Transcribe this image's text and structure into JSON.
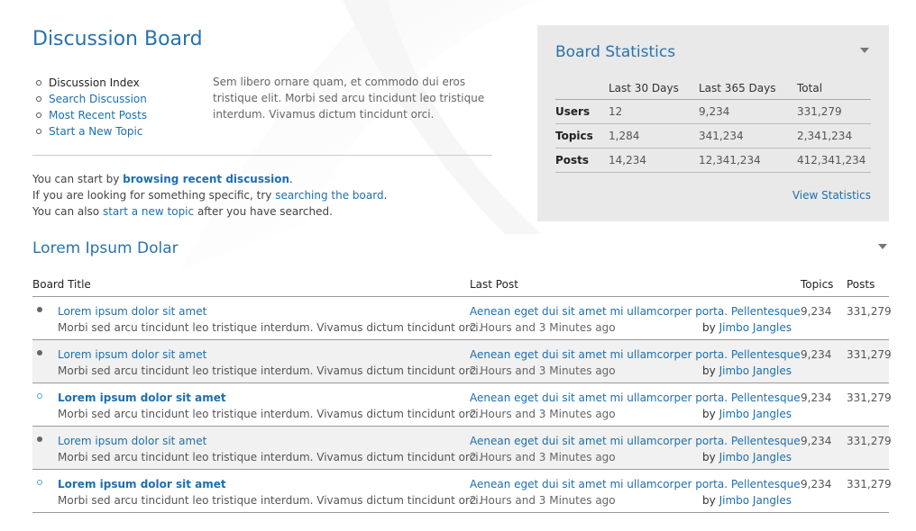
{
  "page": {
    "title": "Discussion Board"
  },
  "nav": {
    "items": [
      {
        "label": "Discussion Index"
      },
      {
        "label": "Search Discussion"
      },
      {
        "label": "Most Recent Posts"
      },
      {
        "label": "Start a New Topic"
      }
    ]
  },
  "intro": {
    "description": "Sem libero ornare quam, et commodo dui eros tristique elit. Morbi sed arcu tincidunt leo tristique interdum. Vivamus dictum tincidunt orci."
  },
  "help": {
    "line1_prefix": "You can start by ",
    "line1_link": "browsing recent discussion",
    "line1_suffix": ".",
    "line2_prefix": "If you are looking for something specific, try ",
    "line2_link": "searching the board",
    "line2_suffix": ".",
    "line3_prefix": "You can also ",
    "line3_link": "start a new topic",
    "line3_suffix": " after you have searched."
  },
  "stats": {
    "title": "Board Statistics",
    "columns": [
      "",
      "Last 30 Days",
      "Last 365 Days",
      "Total"
    ],
    "rows": [
      {
        "label": "Users",
        "last30": "12",
        "last365": "9,234",
        "total": "331,279"
      },
      {
        "label": "Topics",
        "last30": "1,284",
        "last365": "341,234",
        "total": "2,341,234"
      },
      {
        "label": "Posts",
        "last30": "14,234",
        "last365": "12,341,234",
        "total": "412,341,234"
      }
    ],
    "view_link": "View Statistics"
  },
  "section": {
    "title": "Lorem Ipsum Dolar",
    "headers": {
      "board_title": "Board Title",
      "last_post": "Last Post",
      "topics": "Topics",
      "posts": "Posts"
    },
    "rows": [
      {
        "title": "Lorem ipsum dolor sit amet",
        "desc": "Morbi sed arcu tincidunt leo tristique interdum. Vivamus dictum tincidunt orci.",
        "last_post": "Aenean eget dui sit amet mi ullamcorper porta. Pellentesque",
        "time": "2 Hours and 3 Minutes ago",
        "by_prefix": "by ",
        "author": "Jimbo Jangles",
        "topics": "9,234",
        "posts": "331,279"
      },
      {
        "title": "Lorem ipsum dolor sit amet",
        "desc": "Morbi sed arcu tincidunt leo tristique interdum. Vivamus dictum tincidunt orci.",
        "last_post": "Aenean eget dui sit amet mi ullamcorper porta. Pellentesque",
        "time": "2 Hours and 3 Minutes ago",
        "by_prefix": "by ",
        "author": "Jimbo Jangles",
        "topics": "9,234",
        "posts": "331,279"
      },
      {
        "title": "Lorem ipsum dolor sit amet",
        "desc": "Morbi sed arcu tincidunt leo tristique interdum. Vivamus dictum tincidunt orci.",
        "last_post": "Aenean eget dui sit amet mi ullamcorper porta. Pellentesque",
        "time": "2 Hours and 3 Minutes ago",
        "by_prefix": "by ",
        "author": "Jimbo Jangles",
        "topics": "9,234",
        "posts": "331,279"
      },
      {
        "title": "Lorem ipsum dolor sit amet",
        "desc": "Morbi sed arcu tincidunt leo tristique interdum. Vivamus dictum tincidunt orci.",
        "last_post": "Aenean eget dui sit amet mi ullamcorper porta. Pellentesque",
        "time": "2 Hours and 3 Minutes ago",
        "by_prefix": "by ",
        "author": "Jimbo Jangles",
        "topics": "9,234",
        "posts": "331,279"
      },
      {
        "title": "Lorem ipsum dolor sit amet",
        "desc": "Morbi sed arcu tincidunt leo tristique interdum. Vivamus dictum tincidunt orci.",
        "last_post": "Aenean eget dui sit amet mi ullamcorper porta. Pellentesque",
        "time": "2 Hours and 3 Minutes ago",
        "by_prefix": "by ",
        "author": "Jimbo Jangles",
        "topics": "9,234",
        "posts": "331,279"
      }
    ]
  },
  "colors": {
    "accent": "#2a72ad",
    "link": "#1d6fb0",
    "panel_bg": "#e9e9e9",
    "unread_dot": "#4aa3df"
  }
}
